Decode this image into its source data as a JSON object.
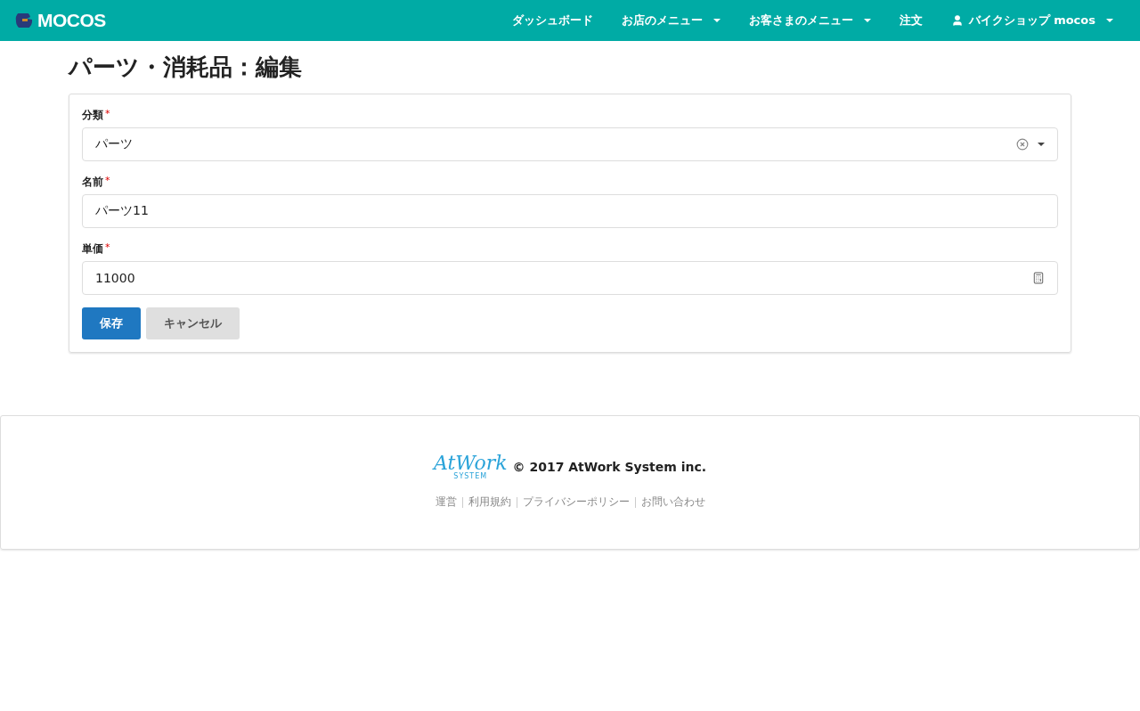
{
  "navbar": {
    "brand": "MOCOS",
    "items": [
      {
        "label": "ダッシュボード",
        "dropdown": false,
        "user": false
      },
      {
        "label": "お店のメニュー",
        "dropdown": true,
        "user": false
      },
      {
        "label": "お客さまのメニュー",
        "dropdown": true,
        "user": false
      },
      {
        "label": "注文",
        "dropdown": false,
        "user": false
      },
      {
        "label": "バイクショップ mocos",
        "dropdown": true,
        "user": true
      }
    ]
  },
  "page_title": "パーツ・消耗品：編集",
  "form": {
    "fields": [
      {
        "kind": "select",
        "label": "分類",
        "required_mark": "*",
        "value": "パーツ"
      },
      {
        "kind": "text",
        "label": "名前",
        "required_mark": "*",
        "value": "パーツ11"
      },
      {
        "kind": "number",
        "label": "単価",
        "required_mark": "*",
        "value": "11000"
      }
    ],
    "buttons": [
      {
        "label": "保存",
        "kind": "primary"
      },
      {
        "label": "キャンセル",
        "kind": "secondary"
      }
    ]
  },
  "footer": {
    "logo_text": "AtWork",
    "logo_subtext": "SYSTEM",
    "copyright": "© 2017 AtWork System inc.",
    "links": [
      "運営",
      "利用規約",
      "プライバシーポリシー",
      "お問い合わせ"
    ]
  }
}
